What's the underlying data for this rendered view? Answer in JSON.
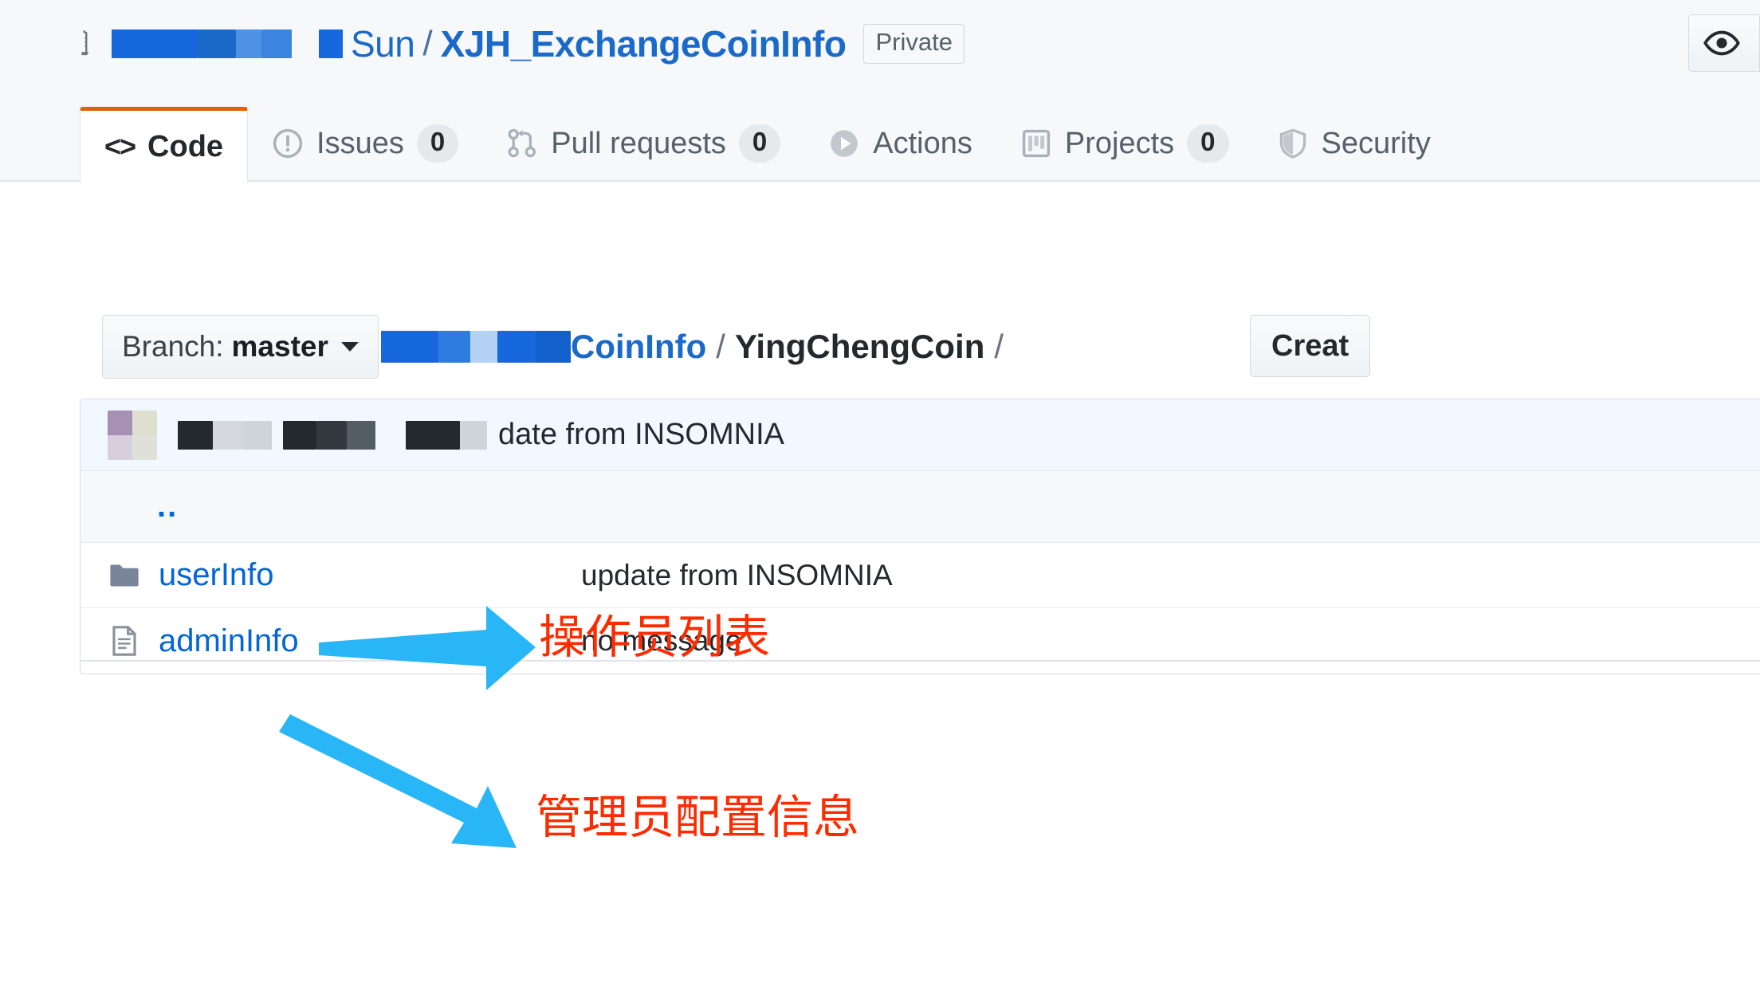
{
  "header": {
    "owner": "Sun",
    "separator": "/",
    "repo_name": "XJH_ExchangeCoinInfo",
    "visibility_badge": "Private",
    "repo_icon": "repo-icon",
    "watch_icon": "eye-icon",
    "redaction_color": "#1668dc"
  },
  "tabs": [
    {
      "label": "Code",
      "icon": "code-icon",
      "count": null,
      "selected": true
    },
    {
      "label": "Issues",
      "icon": "issue-opened-icon",
      "count": "0",
      "selected": false
    },
    {
      "label": "Pull requests",
      "icon": "git-pull-request-icon",
      "count": "0",
      "selected": false
    },
    {
      "label": "Actions",
      "icon": "play-icon",
      "count": null,
      "selected": false
    },
    {
      "label": "Projects",
      "icon": "project-board-icon",
      "count": "0",
      "selected": false
    },
    {
      "label": "Security",
      "icon": "shield-icon",
      "count": null,
      "selected": false
    }
  ],
  "toolbar": {
    "branch_prefix": "Branch:",
    "branch_name": "master",
    "create_label": "Creat",
    "breadcrumb": {
      "root_label": "CoinInfo",
      "current_label": "YingChengCoin",
      "trailing_slash": "/",
      "separator": "/"
    }
  },
  "commit": {
    "message": "date from INSOMNIA",
    "author_redacted": true
  },
  "files": {
    "parent_dir": "..",
    "rows": [
      {
        "name": "userInfo",
        "icon": "folder-icon",
        "message": "update from INSOMNIA"
      },
      {
        "name": "adminInfo",
        "icon": "file-icon",
        "message": "no message"
      }
    ]
  },
  "annotations": {
    "color": "#ff2b00",
    "arrow_color": "#29b6f6",
    "items": [
      {
        "text": "操作员列表",
        "target": "userInfo"
      },
      {
        "text": "管理员配置信息",
        "target": "adminInfo"
      }
    ]
  }
}
